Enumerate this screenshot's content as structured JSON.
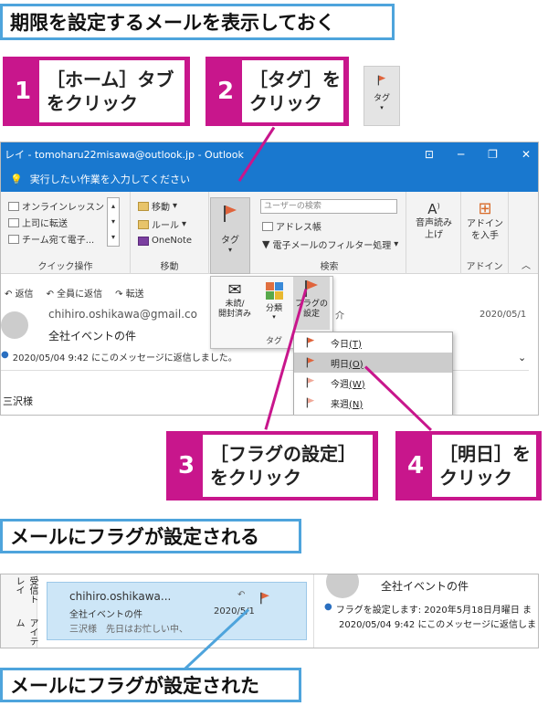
{
  "headers": {
    "h1": "期限を設定するメールを表示しておく",
    "h2": "メールにフラグが設定される",
    "h3": "メールにフラグが設定された"
  },
  "steps": [
    {
      "num": "1",
      "text": "［ホーム］タブ\nをクリック"
    },
    {
      "num": "2",
      "text": "［タグ］を\nクリック"
    },
    {
      "num": "3",
      "text": "［フラグの設定］\nをクリック"
    },
    {
      "num": "4",
      "text": "［明日］を\nクリック"
    }
  ],
  "thumb": {
    "label": "タグ"
  },
  "window": {
    "title": "レイ - tomoharu22misawa@outlook.jp - Outlook",
    "tell": "実行したい作業を入力してください"
  },
  "ribbon": {
    "quick": {
      "items": [
        "オンラインレッスン",
        "上司に転送",
        "チーム宛て電子..."
      ],
      "label": "クイック操作"
    },
    "move": {
      "items": [
        "移動",
        "ルール",
        "OneNote"
      ],
      "label": "移動"
    },
    "tag": {
      "label": "タグ"
    },
    "search": {
      "placeholder": "ユーザーの検索",
      "items": [
        "アドレス帳",
        "電子メールのフィルター処理"
      ],
      "label": "検索"
    },
    "voice": {
      "label": "音声読み\n上げ"
    },
    "addin": {
      "btn": "アドイン\nを入手",
      "label": "アドイン"
    }
  },
  "mail": {
    "actions": [
      "返信",
      "全員に返信",
      "転送"
    ],
    "from": "chihiro.oshikawa@gmail.co",
    "subject": "全社イベントの件",
    "date": "2020/05/1",
    "info": "2020/05/04 9:42 にこのメッセージに返信しました。",
    "body": "三沢様",
    "extra": "介"
  },
  "tagpanel": {
    "unread": "未読/\n開封済み",
    "classify": "分類",
    "flag": "フラグの\n設定",
    "glabel": "タグ"
  },
  "flagmenu": [
    {
      "label": "今日",
      "key": "(T)"
    },
    {
      "label": "明日",
      "key": "(O)"
    },
    {
      "label": "今週",
      "key": "(W)"
    },
    {
      "label": "来週",
      "key": "(N)"
    }
  ],
  "list": {
    "sidebar": [
      "受信トレイ",
      "アイテム"
    ],
    "from": "chihiro.oshikawa...",
    "subject": "全社イベントの件",
    "preview": "三沢様　先日はお忙しい中、",
    "date": "2020/5/1",
    "reading_subject": "全社イベントの件",
    "flag_info": "フラグを設定します: 2020年5月18日月曜日 ま",
    "reply_info": "2020/05/04 9:42 にこのメッセージに返信しました。"
  }
}
